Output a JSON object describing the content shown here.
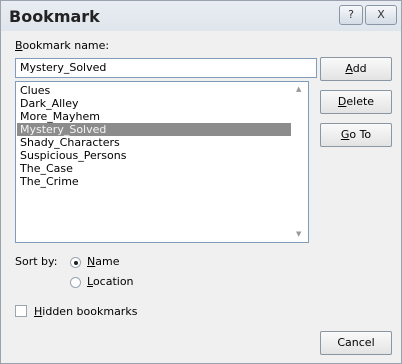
{
  "dialog": {
    "title": "Bookmark",
    "help_icon": "?",
    "close_icon": "X"
  },
  "bookmark_name": {
    "label_mnemonic": "B",
    "label_rest": "ookmark name:",
    "value": "Mystery_Solved"
  },
  "bookmarks": {
    "items": [
      "Clues",
      "Dark_Alley",
      "More_Mayhem",
      "Mystery_Solved",
      "Shady_Characters",
      "Suspicious_Persons",
      "The_Case",
      "The_Crime"
    ],
    "selected_index": 3
  },
  "buttons": {
    "add": {
      "mnemonic": "A",
      "rest": "dd"
    },
    "delete": {
      "mnemonic": "D",
      "rest": "elete"
    },
    "goto": {
      "mnemonic": "G",
      "rest": "o To"
    },
    "cancel": "Cancel"
  },
  "sort": {
    "label": "Sort by:",
    "name": {
      "mnemonic": "N",
      "rest": "ame",
      "selected": true
    },
    "location": {
      "mnemonic": "L",
      "rest": "ocation",
      "selected": false
    }
  },
  "hidden_bookmarks": {
    "mnemonic": "H",
    "rest": "idden bookmarks",
    "checked": false
  },
  "colors": {
    "selection": "#8c8c8c",
    "border": "#7f9db9"
  }
}
